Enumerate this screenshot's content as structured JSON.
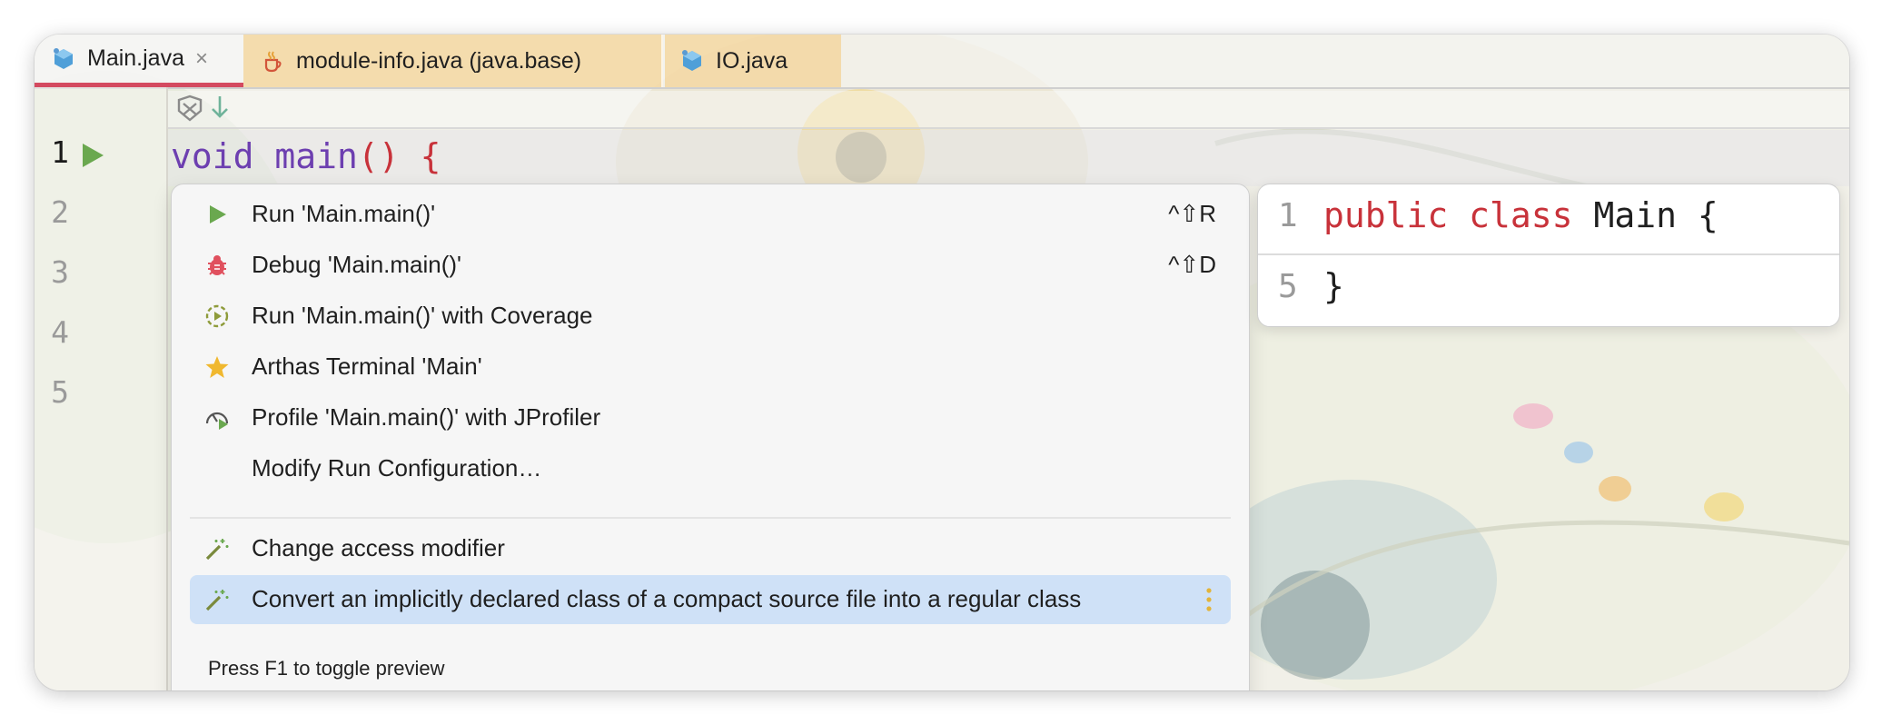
{
  "tabs": [
    {
      "label": "Main.java",
      "icon": "java-class-icon",
      "active": true,
      "close": "×"
    },
    {
      "label": "module-info.java (java.base)",
      "icon": "java-cup-icon",
      "active": false
    },
    {
      "label": "IO.java",
      "icon": "java-class-icon",
      "active": false
    }
  ],
  "gutter": {
    "line_numbers": [
      "1",
      "2",
      "3",
      "4",
      "5"
    ]
  },
  "code": {
    "line1": {
      "kw": "void",
      "name": "main",
      "parens": "()",
      "brace": "{"
    }
  },
  "popup": {
    "items": [
      {
        "icon": "run-icon",
        "label": "Run 'Main.main()'",
        "shortcut": "^⇧R"
      },
      {
        "icon": "debug-icon",
        "label": "Debug 'Main.main()'",
        "shortcut": "^⇧D"
      },
      {
        "icon": "coverage-icon",
        "label": "Run 'Main.main()' with Coverage",
        "shortcut": ""
      },
      {
        "icon": "star-icon",
        "label": "Arthas Terminal 'Main'",
        "shortcut": ""
      },
      {
        "icon": "profiler-icon",
        "label": "Profile 'Main.main()' with JProfiler",
        "shortcut": ""
      },
      {
        "icon": "",
        "label": "Modify Run Configuration…",
        "shortcut": ""
      },
      {
        "icon": "magic-wand-icon",
        "label": "Change access modifier",
        "shortcut": ""
      },
      {
        "icon": "magic-wand-icon",
        "label": "Convert an implicitly declared class of a compact source file into a regular class",
        "shortcut": "",
        "selected": true
      }
    ],
    "footer": "Press F1 to toggle preview"
  },
  "preview": {
    "line1_number": "1",
    "line1_kw1": "public",
    "line1_kw2": "class",
    "line1_rest": "Main {",
    "line2_number": "5",
    "line2_code": "}"
  },
  "colors": {
    "accent_tab": "#d44a60",
    "keyword_purple": "#6d3fb0",
    "keyword_red": "#c8323a",
    "selection": "#cfe1f7",
    "run_green": "#6aa84f"
  }
}
